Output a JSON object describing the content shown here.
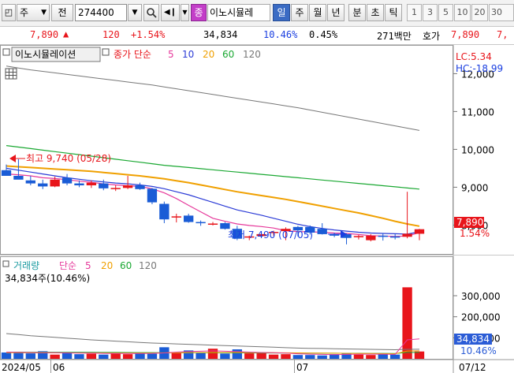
{
  "toolbar": {
    "type_label": "주",
    "prefix_label": "전",
    "code_value": "274400",
    "stock_name": "이노시뮬레",
    "period_labels": [
      "일",
      "주",
      "월",
      "년",
      "분",
      "초",
      "틱"
    ],
    "period_selected": "일",
    "number_labels": [
      "1",
      "3",
      "5",
      "10",
      "20",
      "30"
    ]
  },
  "quote": {
    "price": "7,890",
    "change": "120",
    "change_pct": "+1.54%",
    "volume": "34,834",
    "turnover_pct": "10.46%",
    "ratio_pct": "0.45%",
    "amount": "271백만",
    "ask_label": "호가",
    "ask_price": "7,890",
    "ask_cut": "7,"
  },
  "price_panel": {
    "legend_name": "이노시뮬레이션",
    "legend_ma_label": "종가 단순",
    "ma_periods": [
      "5",
      "10",
      "20",
      "60",
      "120"
    ],
    "lc": "LC:5.34",
    "hc": "HC:-18.99",
    "high_note": "최고 9,740 (05/28)",
    "low_note": "최저 7,490 (07/05)",
    "last_price": "7,890",
    "last_pct": "1.54%"
  },
  "volume_panel": {
    "legend_name": "거래량",
    "legend_ma_label": "단순",
    "ma_periods": [
      "5",
      "20",
      "60",
      "120"
    ],
    "volume_note": "34,834주(10.46%)",
    "last_volume": "34,834",
    "last_pct": "10.46%"
  },
  "date_axis": {
    "labels": [
      "2024/05",
      "06",
      "07",
      "07/12"
    ]
  },
  "colors": {
    "up": "#e8151b",
    "down": "#1a5cd6",
    "ma5": "#e6399b",
    "ma10": "#2b3bd6",
    "ma20": "#f0a000",
    "ma60": "#1aa832",
    "ma120": "#777777"
  },
  "chart_data": [
    {
      "type": "candlestick",
      "y_axis_ticks": [
        "12,000",
        "11,000",
        "10,000",
        "9,000",
        "8,000"
      ],
      "ylim": [
        7300,
        12300
      ],
      "candles": [
        {
          "o": 9450,
          "h": 9600,
          "l": 9300,
          "c": 9300
        },
        {
          "o": 9300,
          "h": 9740,
          "l": 9250,
          "c": 9200
        },
        {
          "o": 9180,
          "h": 9300,
          "l": 9050,
          "c": 9100
        },
        {
          "o": 9100,
          "h": 9200,
          "l": 8950,
          "c": 9020
        },
        {
          "o": 9020,
          "h": 9280,
          "l": 9000,
          "c": 9200
        },
        {
          "o": 9250,
          "h": 9350,
          "l": 9050,
          "c": 9100
        },
        {
          "o": 9100,
          "h": 9180,
          "l": 9000,
          "c": 9050
        },
        {
          "o": 9050,
          "h": 9180,
          "l": 8980,
          "c": 9120
        },
        {
          "o": 9100,
          "h": 9200,
          "l": 8920,
          "c": 8970
        },
        {
          "o": 8970,
          "h": 9050,
          "l": 8900,
          "c": 8980
        },
        {
          "o": 8980,
          "h": 9300,
          "l": 8950,
          "c": 9050
        },
        {
          "o": 9050,
          "h": 9120,
          "l": 8930,
          "c": 8950
        },
        {
          "o": 8960,
          "h": 8980,
          "l": 8550,
          "c": 8600
        },
        {
          "o": 8560,
          "h": 8620,
          "l": 8050,
          "c": 8150
        },
        {
          "o": 8200,
          "h": 8300,
          "l": 8070,
          "c": 8230
        },
        {
          "o": 8250,
          "h": 8300,
          "l": 8060,
          "c": 8080
        },
        {
          "o": 8080,
          "h": 8120,
          "l": 7980,
          "c": 8050
        },
        {
          "o": 8020,
          "h": 8080,
          "l": 7990,
          "c": 8040
        },
        {
          "o": 8050,
          "h": 8080,
          "l": 7880,
          "c": 7900
        },
        {
          "o": 7900,
          "h": 7980,
          "l": 7600,
          "c": 7640
        },
        {
          "o": 7700,
          "h": 7720,
          "l": 7600,
          "c": 7700
        },
        {
          "o": 7710,
          "h": 7780,
          "l": 7690,
          "c": 7760
        },
        {
          "o": 7800,
          "h": 7850,
          "l": 7720,
          "c": 7820
        },
        {
          "o": 7840,
          "h": 7940,
          "l": 7600,
          "c": 7900
        },
        {
          "o": 7950,
          "h": 7980,
          "l": 7700,
          "c": 7860
        },
        {
          "o": 7950,
          "h": 7990,
          "l": 7750,
          "c": 7800
        },
        {
          "o": 7900,
          "h": 8050,
          "l": 7750,
          "c": 7760
        },
        {
          "o": 7760,
          "h": 7800,
          "l": 7680,
          "c": 7720
        },
        {
          "o": 7760,
          "h": 7780,
          "l": 7490,
          "c": 7660
        },
        {
          "o": 7700,
          "h": 7740,
          "l": 7620,
          "c": 7710
        },
        {
          "o": 7600,
          "h": 7760,
          "l": 7570,
          "c": 7720
        },
        {
          "o": 7720,
          "h": 7790,
          "l": 7590,
          "c": 7700
        },
        {
          "o": 7700,
          "h": 7760,
          "l": 7620,
          "c": 7690
        },
        {
          "o": 7690,
          "h": 8880,
          "l": 7650,
          "c": 7770
        },
        {
          "o": 7770,
          "h": 7900,
          "l": 7600,
          "c": 7890
        }
      ],
      "ma5": [
        9350,
        9330,
        9300,
        9250,
        9230,
        9200,
        9160,
        9130,
        9090,
        9060,
        9040,
        9020,
        8960,
        8850,
        8700,
        8520,
        8350,
        8180,
        8100,
        8030,
        7990,
        7960,
        7920,
        7850,
        7830,
        7820,
        7810,
        7790,
        7780,
        7750,
        7720,
        7710,
        7700,
        7710,
        7800
      ],
      "ma10": [
        9500,
        9450,
        9400,
        9350,
        9300,
        9250,
        9210,
        9170,
        9140,
        9110,
        9090,
        9060,
        9020,
        8960,
        8880,
        8800,
        8700,
        8600,
        8500,
        8400,
        8330,
        8260,
        8180,
        8100,
        8020,
        7960,
        7910,
        7870,
        7840,
        7810,
        7790,
        7780,
        7770,
        7760,
        7820
      ],
      "ma20": [
        9560,
        9540,
        9520,
        9500,
        9480,
        9460,
        9440,
        9420,
        9390,
        9360,
        9330,
        9300,
        9260,
        9220,
        9170,
        9120,
        9060,
        9000,
        8940,
        8880,
        8830,
        8780,
        8730,
        8680,
        8620,
        8560,
        8500,
        8440,
        8380,
        8320,
        8250,
        8180,
        8100,
        8030,
        7970
      ],
      "ma60": [
        10100,
        10060,
        10020,
        9980,
        9940,
        9900,
        9860,
        9820,
        9780,
        9740,
        9700,
        9660,
        9620,
        9580,
        9550,
        9520,
        9490,
        9460,
        9430,
        9400,
        9370,
        9340,
        9310,
        9280,
        9250,
        9220,
        9190,
        9160,
        9130,
        9100,
        9070,
        9040,
        9010,
        8980,
        8950
      ],
      "ma120": [
        12200,
        12150,
        12100,
        12060,
        12020,
        11980,
        11940,
        11900,
        11860,
        11820,
        11780,
        11740,
        11700,
        11650,
        11600,
        11550,
        11500,
        11450,
        11400,
        11350,
        11300,
        11250,
        11200,
        11150,
        11100,
        11040,
        10980,
        10920,
        10860,
        10800,
        10740,
        10680,
        10620,
        10560,
        10500
      ]
    },
    {
      "type": "bar",
      "y_axis_ticks": [
        "300,000",
        "200,000",
        "100,000"
      ],
      "ylim": [
        0,
        420000
      ],
      "volumes": [
        30000,
        32000,
        26000,
        36000,
        20000,
        28000,
        22000,
        24000,
        20000,
        25000,
        22000,
        26000,
        24000,
        55000,
        30000,
        40000,
        30000,
        48000,
        25000,
        45000,
        26000,
        30000,
        20000,
        22000,
        18000,
        18000,
        16000,
        22000,
        26000,
        20000,
        18000,
        22000,
        20000,
        340000,
        34834
      ],
      "ma5": [
        32000,
        31000,
        30000,
        29500,
        29000,
        28000,
        27000,
        26500,
        26000,
        25500,
        25000,
        25000,
        26000,
        28000,
        32000,
        35000,
        36000,
        38000,
        36000,
        34000,
        32000,
        30000,
        29000,
        27000,
        24000,
        22000,
        21000,
        20000,
        21000,
        22000,
        22000,
        22000,
        21000,
        90000,
        95000
      ],
      "ma20": [
        29000,
        29000,
        28500,
        28500,
        28000,
        28000,
        27800,
        27600,
        27400,
        27200,
        27000,
        27000,
        27200,
        28000,
        28500,
        29000,
        29500,
        30000,
        30000,
        30000,
        29800,
        29500,
        29000,
        28500,
        28000,
        27500,
        27000,
        26500,
        26000,
        25500,
        25000,
        24500,
        24000,
        37000,
        38000
      ],
      "ma60": [
        32000,
        31800,
        31600,
        31400,
        31200,
        31000,
        30800,
        30600,
        30400,
        30200,
        30000,
        29800,
        29600,
        29400,
        29200,
        29000,
        28800,
        28600,
        28400,
        28200,
        28000,
        27800,
        27600,
        27400,
        27200,
        27000,
        26800,
        26600,
        26400,
        26200,
        26000,
        25800,
        25600,
        30000,
        30500
      ],
      "ma120": [
        120000,
        115000,
        110000,
        106000,
        102000,
        98000,
        94000,
        90000,
        87000,
        84000,
        81000,
        78000,
        75000,
        73000,
        71000,
        69000,
        67000,
        65000,
        63000,
        61000,
        59000,
        57000,
        55000,
        53000,
        51000,
        50000,
        49000,
        48000,
        47000,
        46000,
        45000,
        44000,
        43000,
        45000,
        45500
      ]
    }
  ]
}
